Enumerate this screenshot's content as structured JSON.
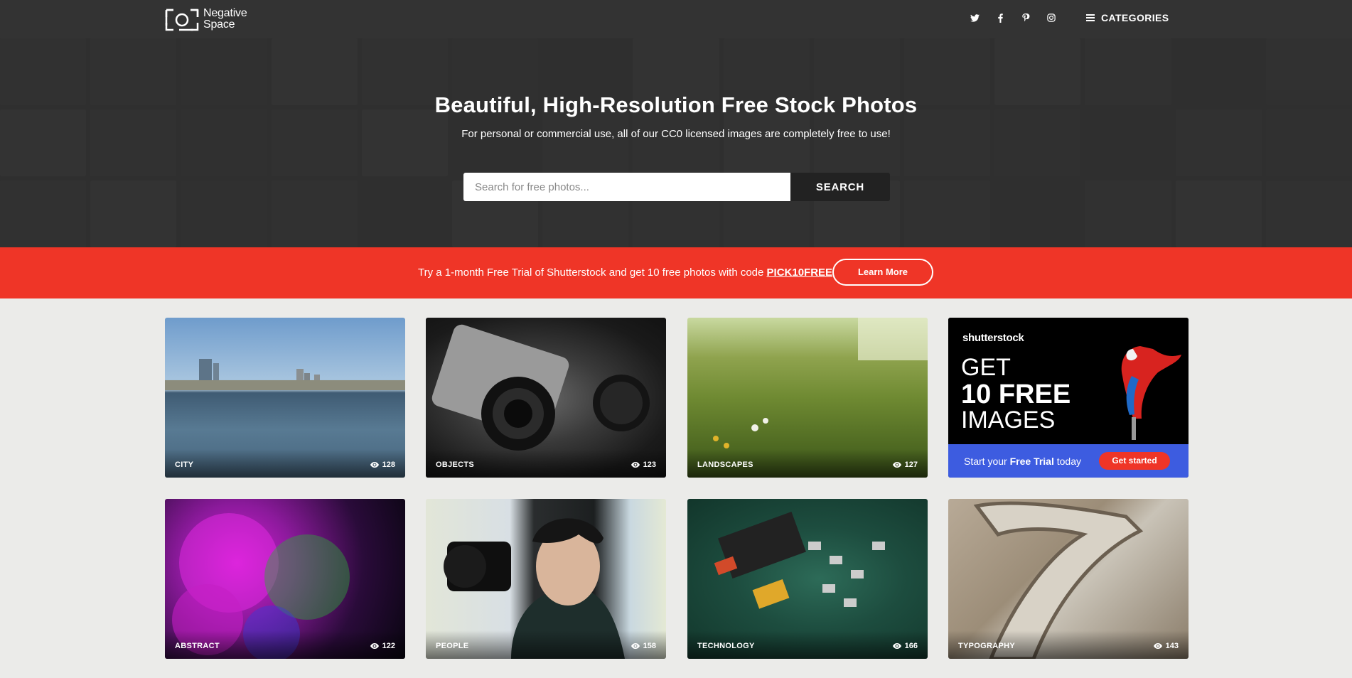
{
  "header": {
    "logo_text": "Negative Space",
    "social": [
      "twitter-icon",
      "facebook-icon",
      "pinterest-icon",
      "instagram-icon"
    ],
    "categories_label": "CATEGORIES"
  },
  "hero": {
    "title": "Beautiful, High-Resolution Free Stock Photos",
    "subtitle": "For personal or commercial use, all of our CC0 licensed images are completely free to use!",
    "search_placeholder": "Search for free photos...",
    "search_button": "SEARCH"
  },
  "promo": {
    "text": "Try a 1-month Free Trial of Shutterstock and get 10 free photos with code ",
    "code": "PICK10FREE",
    "button": "Learn More"
  },
  "cards": [
    {
      "label": "CITY",
      "views": "128"
    },
    {
      "label": "OBJECTS",
      "views": "123"
    },
    {
      "label": "LANDSCAPES",
      "views": "127"
    },
    {
      "label": "ABSTRACT",
      "views": "122"
    },
    {
      "label": "PEOPLE",
      "views": "158"
    },
    {
      "label": "TECHNOLOGY",
      "views": "166"
    },
    {
      "label": "TYPOGRAPHY",
      "views": "143"
    }
  ],
  "ad": {
    "brand": "shutterstock",
    "line1": "GET",
    "line2": "10 FREE",
    "line3": "IMAGES",
    "cta_pre": "Start your ",
    "cta_bold": "Free Trial",
    "cta_post": " today",
    "button": "Get started"
  },
  "colors": {
    "header_bg": "#333333",
    "promo_bg": "#ef3527",
    "ad_blue": "#3d5ce0",
    "page_bg": "#ebebe9"
  }
}
